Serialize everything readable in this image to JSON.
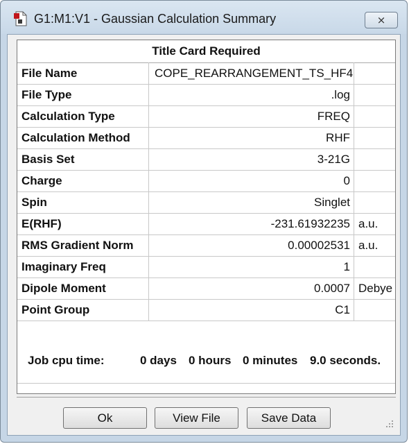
{
  "window": {
    "title": "G1:M1:V1 - Gaussian Calculation Summary",
    "close_glyph": "⨯"
  },
  "summary": {
    "header": "Title Card Required",
    "rows": [
      {
        "label": "File Name",
        "value": "COPE_REARRANGEMENT_TS_HF4",
        "unit": ""
      },
      {
        "label": "File Type",
        "value": ".log",
        "unit": ""
      },
      {
        "label": "Calculation Type",
        "value": "FREQ",
        "unit": ""
      },
      {
        "label": "Calculation Method",
        "value": "RHF",
        "unit": ""
      },
      {
        "label": "Basis Set",
        "value": "3-21G",
        "unit": ""
      },
      {
        "label": "Charge",
        "value": "0",
        "unit": ""
      },
      {
        "label": "Spin",
        "value": "Singlet",
        "unit": ""
      },
      {
        "label": "E(RHF)",
        "value": "-231.61932235",
        "unit": "a.u."
      },
      {
        "label": "RMS Gradient Norm",
        "value": "0.00002531",
        "unit": "a.u."
      },
      {
        "label": "Imaginary Freq",
        "value": "1",
        "unit": ""
      },
      {
        "label": "Dipole Moment",
        "value": "0.0007",
        "unit": "Debye"
      },
      {
        "label": "Point Group",
        "value": "C1",
        "unit": ""
      }
    ],
    "cpu_time": {
      "label": "Job cpu time:",
      "days": "0 days",
      "hours": "0 hours",
      "minutes": "0 minutes",
      "seconds": "9.0 seconds."
    }
  },
  "buttons": {
    "ok": "Ok",
    "view_file": "View File",
    "save_data": "Save Data"
  },
  "icons": {
    "app": "gaussian-document-icon",
    "close": "close-icon",
    "grip": "resize-grip-icon"
  }
}
